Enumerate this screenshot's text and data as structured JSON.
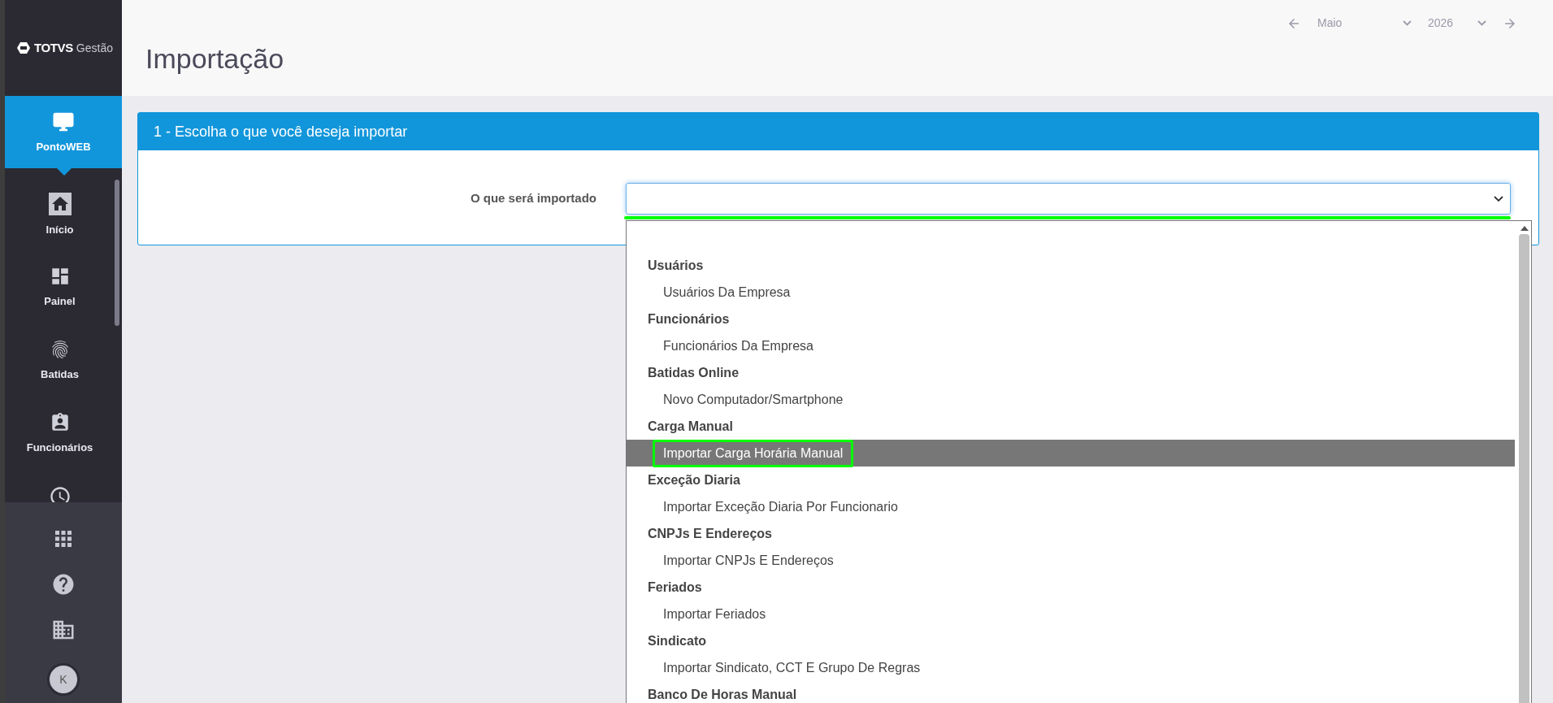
{
  "sidebar": {
    "logo": {
      "brand": "TOTVS",
      "product": "Gestão"
    },
    "module": {
      "label": "PontoWEB"
    },
    "items": [
      {
        "kind": "home",
        "label": "Início"
      },
      {
        "kind": "dashboard",
        "label": "Painel"
      },
      {
        "kind": "fingerprint",
        "label": "Batidas"
      },
      {
        "kind": "badge",
        "label": "Funcionários"
      },
      {
        "kind": "clock"
      }
    ],
    "bottom": [
      {
        "kind": "apps"
      },
      {
        "kind": "help"
      },
      {
        "kind": "building"
      },
      {
        "kind": "avatar",
        "label": "K"
      }
    ]
  },
  "header": {
    "title": "Importação",
    "month": "Maio",
    "year": "2026"
  },
  "panel": {
    "title": "1 - Escolha o que você deseja importar",
    "field_label": "O que será importado",
    "select": {
      "annotated": true
    },
    "options": [
      {
        "kind": "group",
        "label": "Usuários"
      },
      {
        "kind": "option",
        "label": "Usuários Da Empresa",
        "selected": false,
        "annotated": false
      },
      {
        "kind": "group",
        "label": "Funcionários"
      },
      {
        "kind": "option",
        "label": "Funcionários Da Empresa",
        "selected": false,
        "annotated": false
      },
      {
        "kind": "group",
        "label": "Batidas Online"
      },
      {
        "kind": "option",
        "label": "Novo Computador/Smartphone",
        "selected": false,
        "annotated": false
      },
      {
        "kind": "group",
        "label": "Carga Manual"
      },
      {
        "kind": "option",
        "label": "Importar Carga Horária Manual",
        "selected": true,
        "annotated": true
      },
      {
        "kind": "group",
        "label": "Exceção Diaria"
      },
      {
        "kind": "option",
        "label": "Importar Exceção Diaria Por Funcionario",
        "selected": false,
        "annotated": false
      },
      {
        "kind": "group",
        "label": "CNPJs E Endereços"
      },
      {
        "kind": "option",
        "label": "Importar CNPJs E Endereços",
        "selected": false,
        "annotated": false
      },
      {
        "kind": "group",
        "label": "Feriados"
      },
      {
        "kind": "option",
        "label": "Importar Feriados",
        "selected": false,
        "annotated": false
      },
      {
        "kind": "group",
        "label": "Sindicato"
      },
      {
        "kind": "option",
        "label": "Importar Sindicato, CCT E Grupo De Regras",
        "selected": false,
        "annotated": false
      },
      {
        "kind": "group",
        "label": "Banco De Horas Manual"
      }
    ]
  }
}
